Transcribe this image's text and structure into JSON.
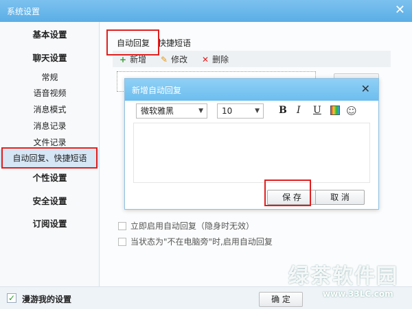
{
  "window": {
    "title": "系统设置"
  },
  "sidebar": {
    "items": [
      {
        "label": "基本设置"
      },
      {
        "label": "聊天设置"
      },
      {
        "label": "常规"
      },
      {
        "label": "语音视频"
      },
      {
        "label": "消息模式"
      },
      {
        "label": "消息记录"
      },
      {
        "label": "文件记录"
      },
      {
        "label": "自动回复、快捷短语"
      },
      {
        "label": "个性设置"
      },
      {
        "label": "安全设置"
      },
      {
        "label": "订阅设置"
      }
    ],
    "active": "自动回复、快捷短语"
  },
  "tabs": [
    {
      "label": "自动回复"
    },
    {
      "label": "快捷短语"
    }
  ],
  "toolbar": {
    "add": "新增",
    "edit": "修改",
    "delete": "删除"
  },
  "options": {
    "enable_now": "立即启用自动回复（隐身时无效）",
    "when_away": "当状态为\"不在电脑旁\"时,启用自动回复"
  },
  "footer": {
    "roam_label": "漫游我的设置",
    "ok_label": "确 定"
  },
  "dialog": {
    "title": "新增自动回复",
    "font_family": "微软雅黑",
    "font_size": "10",
    "save_label": "保 存",
    "cancel_label": "取 消"
  },
  "watermark": {
    "text": "绿茶软件园",
    "url": "www.33LC.com"
  },
  "colors": {
    "title_blue": "#5aaee6",
    "highlight_red": "#e01e1e",
    "check_green": "#2a9a2a"
  }
}
